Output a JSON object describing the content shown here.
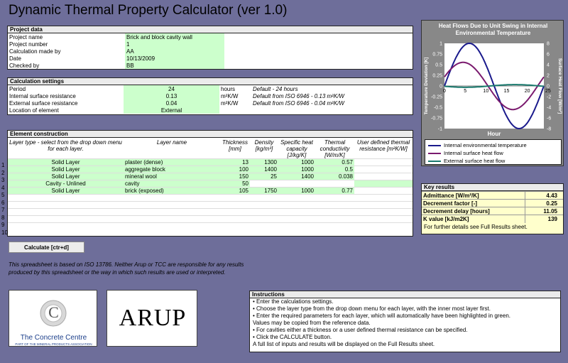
{
  "app_title": "Dynamic Thermal Property Calculator (ver 1.0)",
  "project": {
    "header": "Project data",
    "rows": [
      {
        "label": "Project name",
        "value": "Brick and block cavity wall"
      },
      {
        "label": "Project number",
        "value": "1"
      },
      {
        "label": "Calculation made by",
        "value": "AA"
      },
      {
        "label": "Date",
        "value": "10/13/2009"
      },
      {
        "label": "Checked by",
        "value": "BB"
      }
    ]
  },
  "calc": {
    "header": "Calculation settings",
    "rows": [
      {
        "label": "Period",
        "value": "24",
        "unit": "hours",
        "note": "Default - 24 hours"
      },
      {
        "label": "Internal surface resistance",
        "value": "0.13",
        "unit": "m²K/W",
        "note": "Default from ISO 6946 - 0.13 m²K/W"
      },
      {
        "label": "External surface resistance",
        "value": "0.04",
        "unit": "m²K/W",
        "note": "Default from ISO 6946 - 0.04 m²K/W"
      },
      {
        "label": "Location of element",
        "value": "External",
        "unit": "",
        "note": ""
      }
    ]
  },
  "element": {
    "header": "Element construction",
    "columns": {
      "type": "Layer type - select from the drop down menu for each layer.",
      "name": "Layer name",
      "thickness": "Thickness [mm]",
      "density": "Density [kg/m³]",
      "heat": "Specific heat capacity [J/kg/K]",
      "cond": "Thermal conductivity [W/m/K]",
      "res": "User defined thermal resistance [m²K/W]"
    },
    "rows": [
      {
        "n": "1",
        "type": "Solid Layer",
        "name": "plaster (dense)",
        "thickness": "13",
        "density": "1300",
        "heat": "1000",
        "cond": "0.57",
        "res": ""
      },
      {
        "n": "2",
        "type": "Solid Layer",
        "name": "aggregate block",
        "thickness": "100",
        "density": "1400",
        "heat": "1000",
        "cond": "0.5",
        "res": ""
      },
      {
        "n": "3",
        "type": "Solid Layer",
        "name": "mineral wool",
        "thickness": "150",
        "density": "25",
        "heat": "1400",
        "cond": "0.038",
        "res": ""
      },
      {
        "n": "4",
        "type": "Cavity - Unlined",
        "name": "cavity",
        "thickness": "50",
        "density": "",
        "heat": "",
        "cond": "",
        "res": ""
      },
      {
        "n": "5",
        "type": "Solid Layer",
        "name": "brick (exposed)",
        "thickness": "105",
        "density": "1750",
        "heat": "1000",
        "cond": "0.77",
        "res": ""
      },
      {
        "n": "6",
        "type": "",
        "name": "",
        "thickness": "",
        "density": "",
        "heat": "",
        "cond": "",
        "res": ""
      },
      {
        "n": "7",
        "type": "",
        "name": "",
        "thickness": "",
        "density": "",
        "heat": "",
        "cond": "",
        "res": ""
      },
      {
        "n": "8",
        "type": "",
        "name": "",
        "thickness": "",
        "density": "",
        "heat": "",
        "cond": "",
        "res": ""
      },
      {
        "n": "9",
        "type": "",
        "name": "",
        "thickness": "",
        "density": "",
        "heat": "",
        "cond": "",
        "res": ""
      },
      {
        "n": "10",
        "type": "",
        "name": "",
        "thickness": "",
        "density": "",
        "heat": "",
        "cond": "",
        "res": ""
      }
    ]
  },
  "calculate_label": "Calculate [ctr+d]",
  "disclaimer": "This spreadsheet is based on ISO 13786. Neither Arup or TCC are responsible for any results produced by this spreadsheet or the way in which such results are used or interpreted.",
  "logos": {
    "cc_name": "The Concrete Centre",
    "cc_sub": "PART OF THE MINERAL PRODUCTS ASSOCIATION",
    "cc_mark": "C",
    "arup": "ARUP"
  },
  "key_results": {
    "header": "Key results",
    "rows": [
      {
        "label": "Admittance [W/m²/K]",
        "value": "4.43"
      },
      {
        "label": "Decrement factor [-]",
        "value": "0.25"
      },
      {
        "label": "Decrement delay [hours]",
        "value": "11.05"
      },
      {
        "label": "K value [kJ/m2K]",
        "value": "139"
      }
    ],
    "footer": "For further details see Full Results sheet."
  },
  "instructions": {
    "header": "Instructions",
    "items": [
      "• Enter the calculations settings.",
      "• Choose the layer type from the drop down menu for each layer, with the inner most layer first.",
      "• Enter the required parameters for each layer, which will automatically have been highlighted in green.",
      "  Values may be copied from the reference data.",
      "• For cavities either a thickness or a user defined thermal resistance can be specified.",
      "• Click the CALCULATE button.",
      "  A full list of inputs and results will be displayed on the Full Results sheet."
    ]
  },
  "colors": {
    "background": "#6e6e9a",
    "green_cell": "#ccffcc",
    "series_env": "#1a1a8c",
    "series_int": "#7a1a6e",
    "series_ext": "#1a7a6e"
  },
  "chart_data": {
    "type": "line",
    "title": "Heat Flows Due to Unit Swing in Internal Environmental Temperature",
    "xlabel": "Hour",
    "ylabel_left": "Temperature Deviation [K]",
    "ylabel_right": "Surface Heat Flow [W/m²]",
    "xlim": [
      0,
      24
    ],
    "ylim_left": [
      -1,
      1
    ],
    "ylim_right": [
      -8,
      8
    ],
    "x_ticks": [
      "0",
      "5",
      "10",
      "15",
      "20",
      "25"
    ],
    "y_ticks_left": [
      "1",
      "0.75",
      "0.5",
      "0.25",
      "0",
      "-0.25",
      "-0.5",
      "-0.75",
      "-1"
    ],
    "y_ticks_right": [
      "8",
      "6",
      "4",
      "2",
      "0",
      "-2",
      "-4",
      "-6",
      "-8"
    ],
    "grid": false,
    "legend_placement": "bottom",
    "series": [
      {
        "name": "Internal environmental temperature",
        "axis": "left",
        "amplitude": 1,
        "phase_hours": 0
      },
      {
        "name": "Internal surface heat flow",
        "axis": "right",
        "amplitude": 4.43,
        "phase_hours": -1.5
      },
      {
        "name": "External surface heat flow",
        "axis": "right",
        "amplitude": 0.25,
        "phase_hours": 11.05
      }
    ]
  }
}
